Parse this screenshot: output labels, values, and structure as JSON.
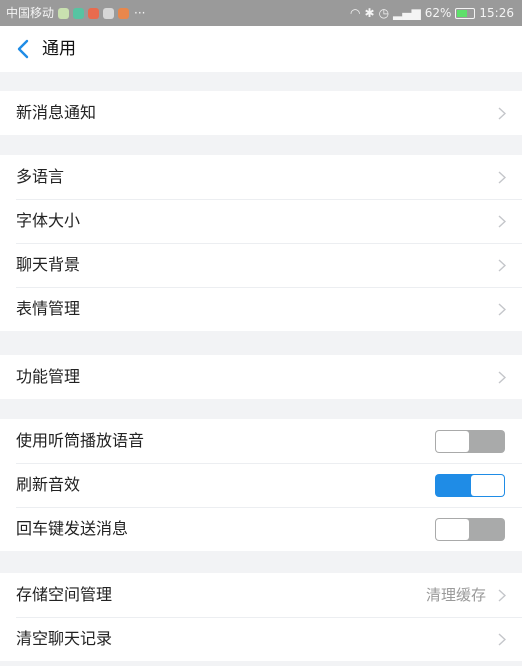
{
  "status_bar": {
    "carrier": "中国移动",
    "more": "···",
    "battery": "62%",
    "time": "15:26",
    "app_icon_colors": [
      "#c9e1b0",
      "#56c4a2",
      "#e86b4e",
      "#d7d7d7",
      "#e8874c"
    ]
  },
  "header": {
    "title": "通用"
  },
  "groups": [
    {
      "items": [
        {
          "label": "新消息通知"
        }
      ]
    },
    {
      "items": [
        {
          "label": "多语言"
        },
        {
          "label": "字体大小"
        },
        {
          "label": "聊天背景"
        },
        {
          "label": "表情管理"
        }
      ]
    },
    {
      "items": [
        {
          "label": "功能管理"
        }
      ]
    },
    {
      "items": [
        {
          "label": "使用听筒播放语音",
          "toggle": false
        },
        {
          "label": "刷新音效",
          "toggle": true
        },
        {
          "label": "回车键发送消息",
          "toggle": false
        }
      ]
    },
    {
      "items": [
        {
          "label": "存储空间管理",
          "extra": "清理缓存"
        },
        {
          "label": "清空聊天记录"
        }
      ]
    }
  ],
  "colors": {
    "accent": "#1f8ce6",
    "page_background": "#f2f3f5",
    "toggle_off": "#a9aaaa"
  }
}
